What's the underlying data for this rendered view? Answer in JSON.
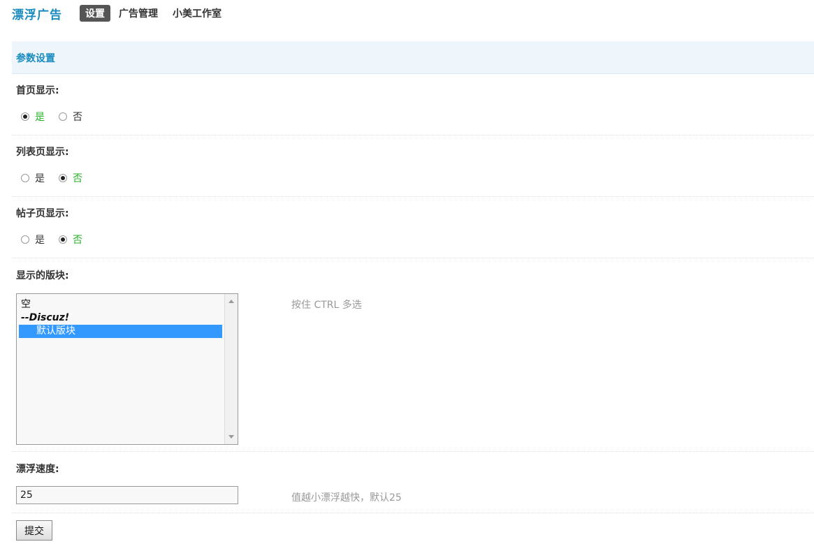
{
  "nav": {
    "brand": "漂浮广告",
    "items": [
      {
        "label": "设置",
        "active": true
      },
      {
        "label": "广告管理",
        "active": false
      },
      {
        "label": "小美工作室",
        "active": false
      }
    ]
  },
  "section": {
    "title": "参数设置"
  },
  "home_display": {
    "label": "首页显示:",
    "yes": "是",
    "no": "否",
    "selected": "yes"
  },
  "list_display": {
    "label": "列表页显示:",
    "yes": "是",
    "no": "否",
    "selected": "no"
  },
  "post_display": {
    "label": "帖子页显示:",
    "yes": "是",
    "no": "否",
    "selected": "no"
  },
  "forums": {
    "label": "显示的版块:",
    "options": [
      {
        "text": "空"
      },
      {
        "text": "--Discuz!"
      },
      {
        "text": "默认版块",
        "selected": true
      }
    ],
    "hint": "按住 CTRL 多选"
  },
  "speed": {
    "label": "漂浮速度:",
    "value": "25",
    "hint": "值越小漂浮越快，默认25"
  },
  "submit": {
    "label": "提交"
  },
  "colors": {
    "accent": "#1a8bbf",
    "selected_text": "#26b126",
    "selection_bg": "#3399ff"
  }
}
